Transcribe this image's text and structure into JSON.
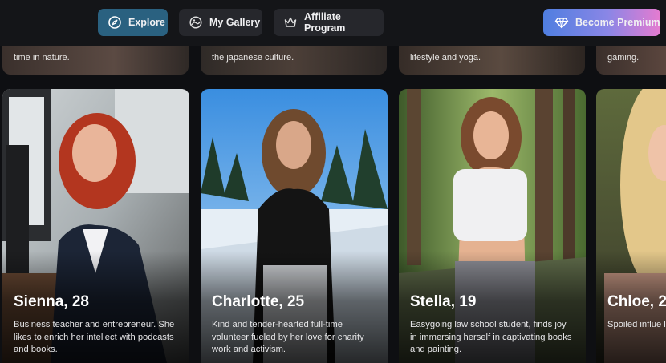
{
  "nav": {
    "explore": "Explore",
    "gallery": "My Gallery",
    "affiliate": "Affiliate Program",
    "premium": "Become Premium"
  },
  "upper_cards": [
    {
      "desc": "time in nature."
    },
    {
      "desc": "the japanese culture."
    },
    {
      "desc": "lifestyle and yoga."
    },
    {
      "desc": "gaming."
    }
  ],
  "cards": [
    {
      "name": "Sienna, 28",
      "bio": "Business teacher and entrepreneur. She likes to enrich her intellect with podcasts and books."
    },
    {
      "name": "Charlotte, 25",
      "bio": "Kind and tender-hearted full-time volunteer fueled by her love for charity work and activism."
    },
    {
      "name": "Stella, 19",
      "bio": "Easygoing law school student, finds joy in immersing herself in captivating books and painting."
    },
    {
      "name": "Chloe, 2",
      "bio": "Spoiled influe life indulging traveling and"
    }
  ],
  "colors": {
    "explore_active": "#2a6180",
    "premium_gradient": [
      "#4f7ee0",
      "#e57bd0"
    ],
    "background": "#0e0f12"
  },
  "icons": [
    "compass-icon",
    "gallery-icon",
    "crown-icon",
    "diamond-icon"
  ]
}
